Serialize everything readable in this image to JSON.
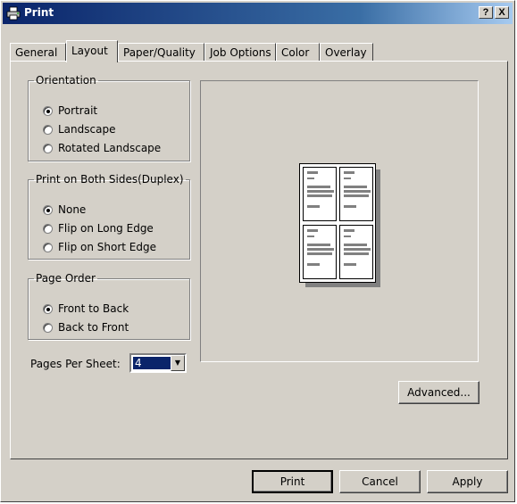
{
  "window": {
    "title": "Print",
    "help": "?",
    "close": "X"
  },
  "tabs": [
    {
      "label": "General"
    },
    {
      "label": "Layout"
    },
    {
      "label": "Paper/Quality"
    },
    {
      "label": "Job Options"
    },
    {
      "label": "Color"
    },
    {
      "label": "Overlay"
    }
  ],
  "orientation": {
    "legend": "Orientation",
    "options": [
      "Portrait",
      "Landscape",
      "Rotated Landscape"
    ],
    "selected": "Portrait"
  },
  "duplex": {
    "legend": "Print on Both Sides(Duplex)",
    "options": [
      "None",
      "Flip on Long Edge",
      "Flip on Short Edge"
    ],
    "selected": "None"
  },
  "page_order": {
    "legend": "Page Order",
    "options": [
      "Front to Back",
      "Back to Front"
    ],
    "selected": "Front to Back"
  },
  "pages_per_sheet": {
    "label": "Pages Per Sheet:",
    "value": "4"
  },
  "buttons": {
    "advanced": "Advanced...",
    "print": "Print",
    "cancel": "Cancel",
    "apply": "Apply"
  }
}
